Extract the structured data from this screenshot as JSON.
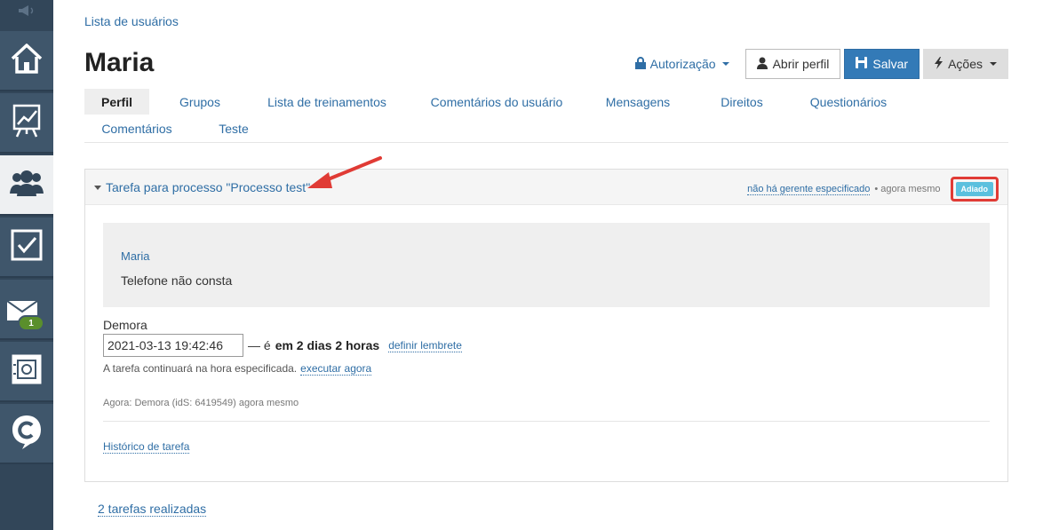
{
  "sidebar": {
    "items": [
      {
        "name": "speaker",
        "icon": "megaphone-icon"
      },
      {
        "name": "home",
        "icon": "home-icon"
      },
      {
        "name": "reports",
        "icon": "chart-icon"
      },
      {
        "name": "users",
        "icon": "users-icon",
        "active": true
      },
      {
        "name": "tasks",
        "icon": "checkbox-icon"
      },
      {
        "name": "messages",
        "icon": "envelope-icon",
        "badge": "1"
      },
      {
        "name": "safe",
        "icon": "safe-icon"
      },
      {
        "name": "chat",
        "icon": "chat-icon"
      }
    ]
  },
  "breadcrumb": "Lista de usuários",
  "page_title": "Maria",
  "toolbar": {
    "authorization": "Autorização",
    "open_profile": "Abrir perfil",
    "save": "Salvar",
    "actions": "Ações"
  },
  "tabs": [
    "Perfil",
    "Grupos",
    "Lista de treinamentos",
    "Comentários do usuário",
    "Mensagens",
    "Direitos",
    "Questionários",
    "Comentários",
    "Teste"
  ],
  "task": {
    "title": "Tarefa para processo \"Processo test\"",
    "manager": "não há gerente especificado",
    "time": "• agora mesmo",
    "status": "Adiado",
    "contact_name": "Maria",
    "contact_phone": "Telefone não consta",
    "delay_label": "Demora",
    "delay_value": "2021-03-13 19:42:46",
    "delay_prefix": "— é",
    "delay_relative": "em 2 dias 2 horas",
    "set_reminder": "definir lembrete",
    "continue_note": "A tarefa continuará na hora especificada.",
    "run_now": "executar agora",
    "now_note": "Agora: Demora (idS: 6419549) agora mesmo",
    "history": "Histórico de tarefa"
  },
  "completed_tasks": "2 tarefas realizadas",
  "colors": {
    "sidebar": "#324659",
    "link": "#2f6ea5",
    "primary": "#337ab7",
    "status": "#5bc0de",
    "highlight": "#e03b35"
  }
}
